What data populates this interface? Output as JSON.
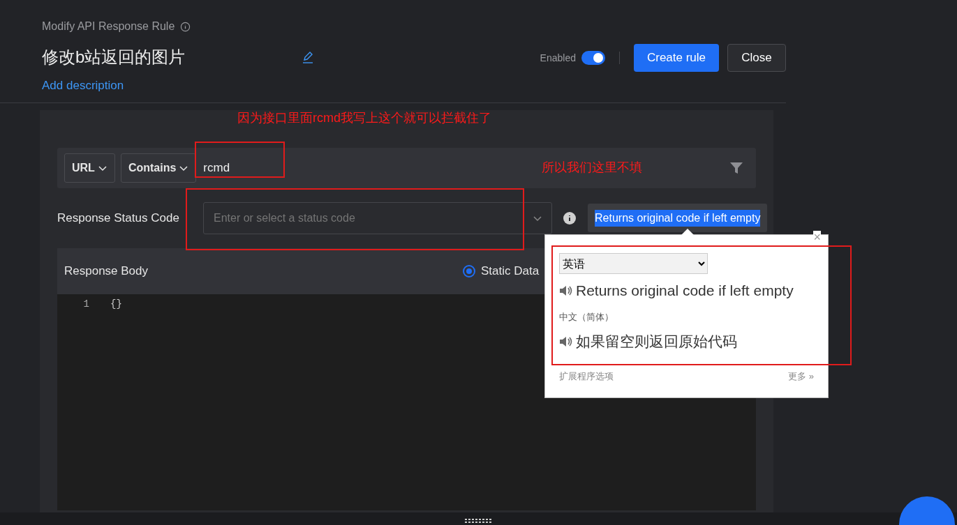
{
  "header": {
    "subtitle": "Modify API Response Rule",
    "rule_name": "修改b站返回的图片",
    "add_description": "Add description",
    "enabled_label": "Enabled",
    "enabled": {
      "on": true
    },
    "buttons": [
      {
        "label": "Create rule",
        "kind": "primary"
      },
      {
        "label": "Close",
        "kind": "secondary"
      }
    ]
  },
  "filter": {
    "source": "URL",
    "operator": "Contains",
    "value": "rcmd"
  },
  "status_code": {
    "label": "Response Status Code",
    "placeholder": "Enter or select a status code",
    "tooltip": "Returns original code if left empty"
  },
  "response_body": {
    "label": "Response Body",
    "options": [
      {
        "label": "Static Data",
        "selected": true
      }
    ],
    "lines": [
      {
        "number": "1",
        "code": "{}"
      }
    ]
  },
  "translate_popup": {
    "close": "×",
    "source_language": "英语",
    "source_text": "Returns original code if left empty",
    "target_language": "中文（简体）",
    "target_text": "如果留空则返回原始代码",
    "options_link": "扩展程序选项",
    "more_link": "更多 »"
  },
  "annotations": [
    {
      "text": "因为接口里面rcmd我写上这个就可以拦截住了"
    },
    {
      "text": "所以我们这里不填"
    }
  ]
}
